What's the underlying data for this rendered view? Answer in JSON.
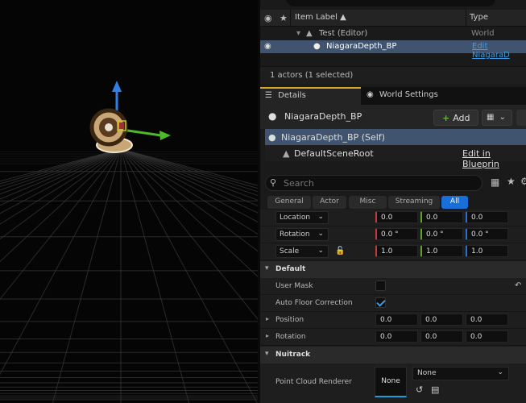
{
  "viewport": {
    "grid_color": "#3a3a3a",
    "axis_colors": {
      "x": "#5cc82c",
      "z": "#3a86e6"
    }
  },
  "outliner": {
    "header": {
      "visibility_icon": "eye-icon",
      "pin_icon": "star-icon",
      "item_label": "Item Label ▲",
      "type": "Type"
    },
    "rows": [
      {
        "label": "Test (Editor)",
        "type": "World",
        "icon": "level-icon"
      },
      {
        "label": "NiagaraDepth_BP",
        "type": "Edit NiagaraD",
        "icon": "actor-icon",
        "selected": true
      }
    ],
    "footer": "1 actors (1 selected)"
  },
  "tabs": [
    {
      "label": "Details",
      "icon": "details-icon",
      "active": true
    },
    {
      "label": "World Settings",
      "icon": "globe-icon",
      "active": false
    }
  ],
  "details": {
    "actor_name": "NiagaraDepth_BP",
    "add_label": "Add",
    "components": [
      {
        "label": "NiagaraDepth_BP (Self)",
        "selected": true
      },
      {
        "label": "DefaultSceneRoot",
        "link": "Edit in Blueprin"
      }
    ],
    "search_placeholder": "Search",
    "filters": [
      "General",
      "Actor",
      "Misc",
      "Streaming",
      "All"
    ],
    "active_filter": "All",
    "transform": [
      {
        "label": "Location",
        "values": [
          "0.0",
          "0.0",
          "0.0"
        ]
      },
      {
        "label": "Rotation",
        "values": [
          "0.0 °",
          "0.0 °",
          "0.0 °"
        ]
      },
      {
        "label": "Scale",
        "values": [
          "1.0",
          "1.0",
          "1.0"
        ]
      }
    ],
    "default_section": {
      "title": "Default",
      "user_mask": "User Mask",
      "auto_floor": "Auto Floor Correction",
      "auto_floor_checked": true,
      "position": {
        "label": "Position",
        "values": [
          "0.0",
          "0.0",
          "0.0"
        ]
      },
      "rotation": {
        "label": "Rotation",
        "values": [
          "0.0",
          "0.0",
          "0.0"
        ]
      }
    },
    "nuitrack_section": {
      "title": "Nuitrack",
      "point_cloud": "Point Cloud Renderer",
      "thumb_label": "None",
      "dropdown_value": "None"
    }
  }
}
